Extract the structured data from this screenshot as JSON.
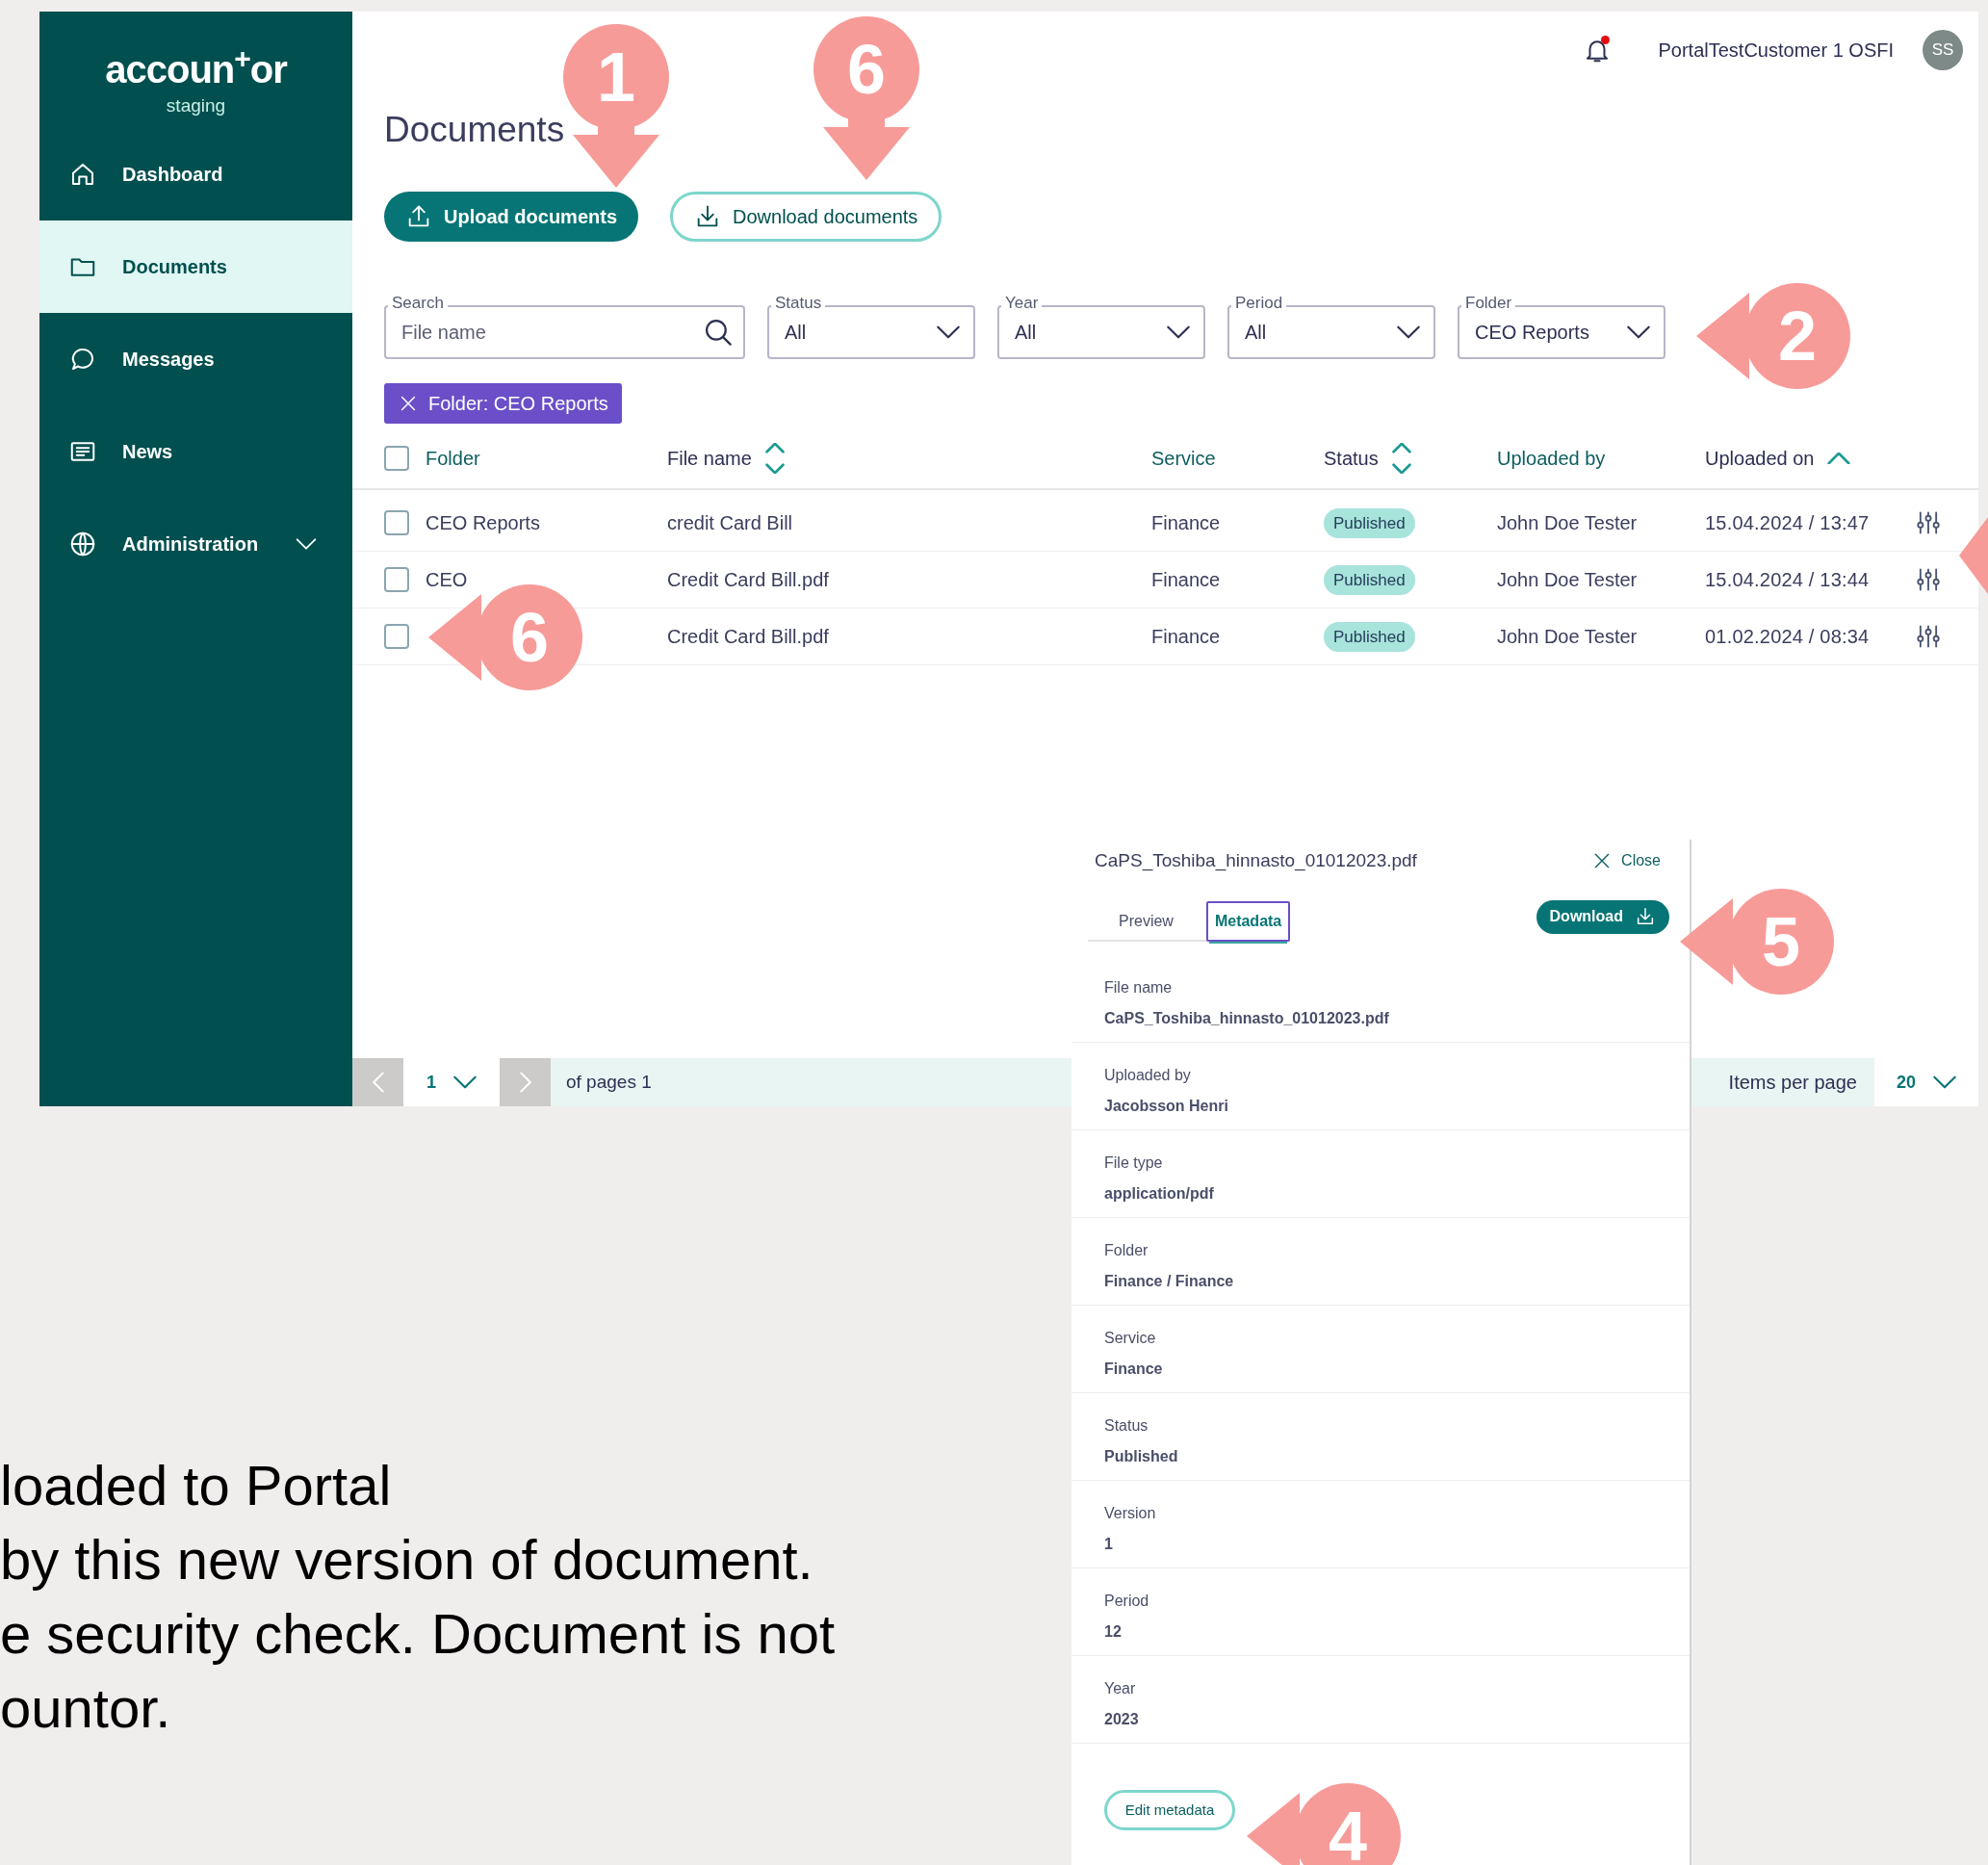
{
  "sidebar": {
    "logo": "accoun$^{+}$or",
    "environment": "staging",
    "items": [
      {
        "label": "Dashboard",
        "selected": false,
        "has_submenu": false
      },
      {
        "label": "Documents",
        "selected": true,
        "has_submenu": false
      },
      {
        "label": "Messages",
        "selected": false,
        "has_submenu": false
      },
      {
        "label": "News",
        "selected": false,
        "has_submenu": false
      },
      {
        "label": "Administration",
        "selected": false,
        "has_submenu": true
      }
    ]
  },
  "header": {
    "has_notification": true,
    "user": "PortalTestCustomer 1 OSFI",
    "avatar": "SS"
  },
  "title": "Documents",
  "actions": [
    {
      "label": "Upload documents",
      "kind": "primary"
    },
    {
      "label": "Download documents",
      "kind": "secondary"
    }
  ],
  "filters": [
    {
      "kind": "search",
      "label": "Search",
      "placeholder": "File name"
    },
    {
      "kind": "select",
      "label": "Status",
      "value": "All"
    },
    {
      "kind": "select",
      "label": "Year",
      "value": "All"
    },
    {
      "kind": "select",
      "label": "Period",
      "value": "All"
    },
    {
      "kind": "select",
      "label": "Folder",
      "value": "CEO Reports"
    }
  ],
  "active_filters": [
    {
      "label": "Folder: CEO Reports"
    }
  ],
  "table": {
    "select_all_checked": false,
    "columns": [
      {
        "label": "Folder",
        "sortable": false,
        "sorted": false
      },
      {
        "label": "File name",
        "sortable": true,
        "sorted": false
      },
      {
        "label": "Service",
        "sortable": false,
        "sorted": false
      },
      {
        "label": "Status",
        "sortable": true,
        "sorted": false
      },
      {
        "label": "Uploaded by",
        "sortable": false,
        "sorted": false
      },
      {
        "label": "Uploaded on",
        "sortable": true,
        "sorted": true
      }
    ],
    "rows": [
      {
        "checked": false,
        "folder": "CEO Reports",
        "file_name": "credit Card Bill",
        "service": "Finance",
        "status": "Published",
        "uploaded_by": "John Doe Tester",
        "uploaded_on": "15.04.2024 / 13:47"
      },
      {
        "checked": false,
        "folder": "CEO",
        "file_name": "Credit Card Bill.pdf",
        "service": "Finance",
        "status": "Published",
        "uploaded_by": "John Doe Tester",
        "uploaded_on": "15.04.2024 / 13:44"
      },
      {
        "checked": false,
        "file_name": "Credit Card Bill.pdf",
        "service": "Finance",
        "status": "Published",
        "uploaded_by": "John Doe Tester",
        "uploaded_on": "01.02.2024 / 08:34"
      }
    ]
  },
  "pagination": {
    "page": "1",
    "of_pages": "of pages 1",
    "items_per_page_label": "Items per page",
    "items_per_page": "20"
  },
  "panel": {
    "title": "CaPS_Toshiba_hinnasto_01012023.pdf",
    "close": "Close",
    "tabs": [
      {
        "label": "Preview",
        "selected": false
      },
      {
        "label": "Metadata",
        "selected": true
      }
    ],
    "download": "Download",
    "fields": [
      {
        "label": "File name",
        "value": "CaPS_Toshiba_hinnasto_01012023.pdf"
      },
      {
        "label": "Uploaded by",
        "value": "Jacobsson Henri"
      },
      {
        "label": "File type",
        "value": "application/pdf"
      },
      {
        "label": "Folder",
        "value": "Finance / Finance"
      },
      {
        "label": "Service",
        "value": "Finance"
      },
      {
        "label": "Status",
        "value": "Published"
      },
      {
        "label": "Version",
        "value": "1"
      },
      {
        "label": "Period",
        "value": "12"
      },
      {
        "label": "Year",
        "value": "2023"
      }
    ],
    "edit": "Edit metadata"
  },
  "callouts": [
    {
      "number": "1",
      "kind": "down"
    },
    {
      "number": "6",
      "kind": "down"
    },
    {
      "number": "2",
      "kind": "left"
    },
    {
      "number": "6",
      "kind": "left"
    },
    {
      "number": "5",
      "kind": "left"
    },
    {
      "number": "4",
      "kind": "left"
    }
  ],
  "slide_text": [
    "loaded to Portal",
    "by this new version of document.",
    "e security check. Document is not",
    "ountor."
  ]
}
